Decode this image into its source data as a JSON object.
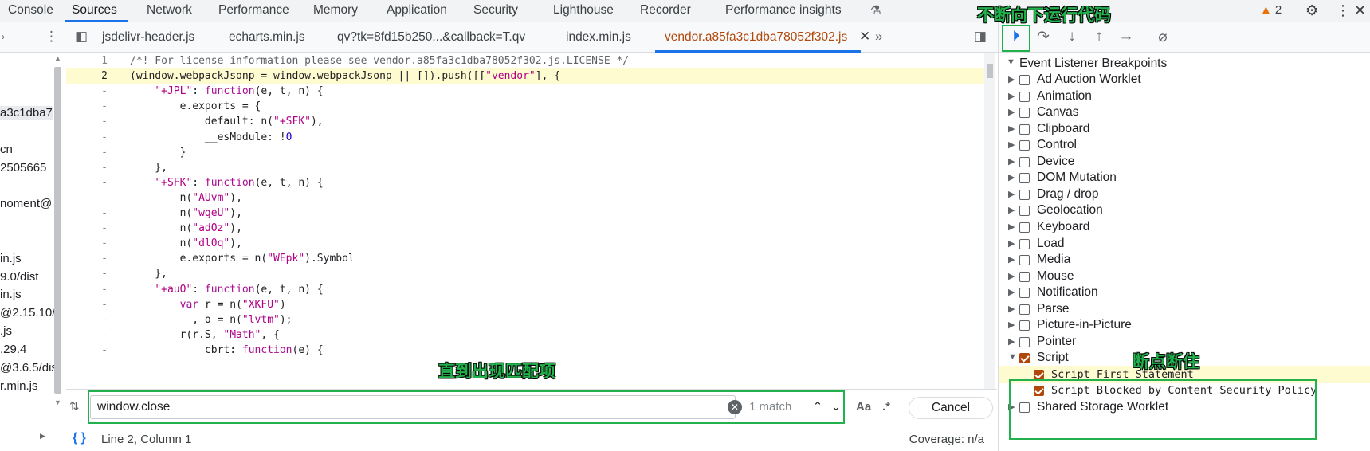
{
  "panel_tabs": [
    {
      "label": "Console"
    },
    {
      "label": "Sources"
    },
    {
      "label": "Network"
    },
    {
      "label": "Performance"
    },
    {
      "label": "Memory"
    },
    {
      "label": "Application"
    },
    {
      "label": "Security"
    },
    {
      "label": "Lighthouse"
    },
    {
      "label": "Recorder"
    },
    {
      "label": "Performance insights"
    }
  ],
  "warnings": {
    "icon": "warning-triangle-icon",
    "count": "2"
  },
  "file_tabs": [
    {
      "label": "jsdelivr-header.js"
    },
    {
      "label": "echarts.min.js"
    },
    {
      "label": "qv?tk=8fd15b250...&callback=T.qv"
    },
    {
      "label": "index.min.js"
    },
    {
      "label": "vendor.a85fa3c1dba78052f302.js"
    }
  ],
  "navigator": {
    "items": [
      "a3c1dba7",
      "cn",
      "2505665",
      "noment@",
      "in.js",
      "9.0/dist",
      "in.js",
      "@2.15.10/",
      ".js",
      ".29.4",
      "@3.6.5/dis",
      "r.min.js"
    ]
  },
  "code": {
    "lines": [
      {
        "n": "1",
        "text": "/*! For license information please see vendor.a85fa3c1dba78052f302.js.LICENSE */"
      },
      {
        "n": "2",
        "text": "(window.webpackJsonp = window.webpackJsonp || []).push([[\"vendor\"], {"
      },
      {
        "n": "-",
        "text": "    \"+JPL\": function(e, t, n) {"
      },
      {
        "n": "-",
        "text": "        e.exports = {"
      },
      {
        "n": "-",
        "text": "            default: n(\"+SFK\"),"
      },
      {
        "n": "-",
        "text": "            __esModule: !0"
      },
      {
        "n": "-",
        "text": "        }"
      },
      {
        "n": "-",
        "text": "    },"
      },
      {
        "n": "-",
        "text": "    \"+SFK\": function(e, t, n) {"
      },
      {
        "n": "-",
        "text": "        n(\"AUvm\"),"
      },
      {
        "n": "-",
        "text": "        n(\"wgeU\"),"
      },
      {
        "n": "-",
        "text": "        n(\"adOz\"),"
      },
      {
        "n": "-",
        "text": "        n(\"dl0q\"),"
      },
      {
        "n": "-",
        "text": "        e.exports = n(\"WEpk\").Symbol"
      },
      {
        "n": "-",
        "text": "    },"
      },
      {
        "n": "-",
        "text": "    \"+auO\": function(e, t, n) {"
      },
      {
        "n": "-",
        "text": "        var r = n(\"XKFU\")"
      },
      {
        "n": "-",
        "text": "          , o = n(\"lvtm\");"
      },
      {
        "n": "-",
        "text": "        r(r.S, \"Math\", {"
      },
      {
        "n": "-",
        "text": "            cbrt: function(e) {"
      }
    ]
  },
  "search": {
    "value": "window.close",
    "match_count": "1 match",
    "match_case_label": "Aa",
    "regex_label": ".*",
    "cancel_label": "Cancel"
  },
  "status": {
    "braces_label": "{ }",
    "position": "Line 2, Column 1",
    "coverage": "Coverage: n/a"
  },
  "breakpoints": {
    "section_title": "Event Listener Breakpoints",
    "items": [
      {
        "label": "Ad Auction Worklet",
        "checked": false
      },
      {
        "label": "Animation",
        "checked": false
      },
      {
        "label": "Canvas",
        "checked": false
      },
      {
        "label": "Clipboard",
        "checked": false
      },
      {
        "label": "Control",
        "checked": false
      },
      {
        "label": "Device",
        "checked": false
      },
      {
        "label": "DOM Mutation",
        "checked": false
      },
      {
        "label": "Drag / drop",
        "checked": false
      },
      {
        "label": "Geolocation",
        "checked": false
      },
      {
        "label": "Keyboard",
        "checked": false
      },
      {
        "label": "Load",
        "checked": false
      },
      {
        "label": "Media",
        "checked": false
      },
      {
        "label": "Mouse",
        "checked": false
      },
      {
        "label": "Notification",
        "checked": false
      },
      {
        "label": "Parse",
        "checked": false
      },
      {
        "label": "Picture-in-Picture",
        "checked": false
      },
      {
        "label": "Pointer",
        "checked": false
      },
      {
        "label": "Script",
        "checked": true
      },
      {
        "label": "Shared Storage Worklet",
        "checked": false
      }
    ],
    "script_children": [
      {
        "label": "Script First Statement",
        "checked": true
      },
      {
        "label": "Script Blocked by Content Security Policy",
        "checked": true
      }
    ]
  },
  "annotations": {
    "resume": "不断向下运行代码",
    "match": "直到出现匹配项",
    "breakpoint": "断点断住",
    "color": "#22b14c"
  },
  "colors": {
    "accent": "#1a73e8",
    "active_file": "#b2470a",
    "highlight": "#fffbd1"
  }
}
